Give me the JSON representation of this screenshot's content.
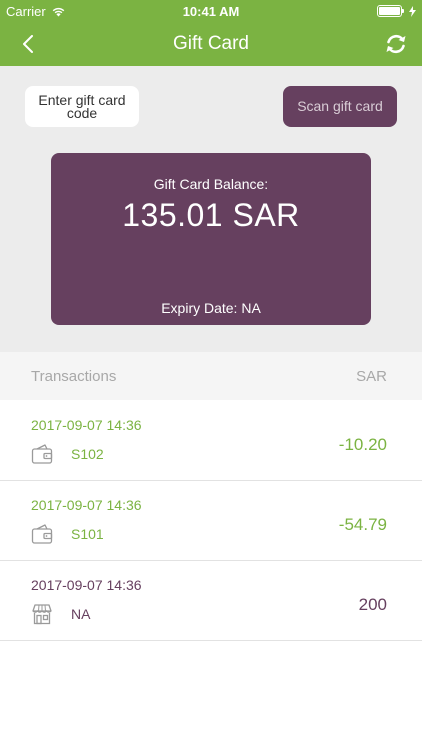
{
  "status_bar": {
    "carrier": "Carrier",
    "time": "10:41 AM"
  },
  "nav": {
    "title": "Gift Card",
    "back_icon": "chevron-left-icon",
    "refresh_icon": "refresh-icon"
  },
  "actions": {
    "enter_code_label": "Enter gift card code",
    "scan_label": "Scan gift card"
  },
  "balance": {
    "label": "Gift Card Balance:",
    "amount": "135.01 SAR",
    "expiry": "Expiry Date: NA"
  },
  "transactions": {
    "header_left": "Transactions",
    "header_right": "SAR",
    "items": [
      {
        "date": "2017-09-07 14:36",
        "ref": "S102",
        "amount": "-10.20",
        "icon": "wallet-icon"
      },
      {
        "date": "2017-09-07 14:36",
        "ref": "S101",
        "amount": "-54.79",
        "icon": "wallet-icon"
      },
      {
        "date": "2017-09-07 14:36",
        "ref": "NA",
        "amount": "200",
        "icon": "store-icon"
      }
    ]
  },
  "colors": {
    "brand_green": "#7bb342",
    "brand_purple": "#66405f",
    "panel_gray": "#ececec"
  }
}
